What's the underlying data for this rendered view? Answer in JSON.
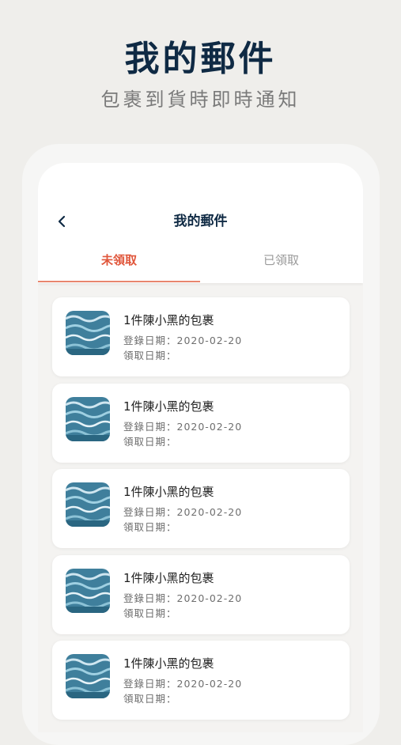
{
  "promo": {
    "title": "我的郵件",
    "subtitle": "包裹到貨時即時通知"
  },
  "nav": {
    "title": "我的郵件",
    "back_icon": "chevron-left-icon"
  },
  "tabs": [
    {
      "label": "未領取",
      "selected": true
    },
    {
      "label": "已領取",
      "selected": false
    }
  ],
  "colors": {
    "accent": "#e0563b",
    "title_navy": "#0f2a44",
    "background": "#efeeeb"
  },
  "parcels": [
    {
      "title": "1件陳小黑的包裹",
      "registered": "登錄日期：2020-02-20",
      "collected": "領取日期："
    },
    {
      "title": "1件陳小黑的包裹",
      "registered": "登錄日期：2020-02-20",
      "collected": "領取日期："
    },
    {
      "title": "1件陳小黑的包裹",
      "registered": "登錄日期：2020-02-20",
      "collected": "領取日期："
    },
    {
      "title": "1件陳小黑的包裹",
      "registered": "登錄日期：2020-02-20",
      "collected": "領取日期："
    },
    {
      "title": "1件陳小黑的包裹",
      "registered": "登錄日期：2020-02-20",
      "collected": "領取日期："
    }
  ]
}
